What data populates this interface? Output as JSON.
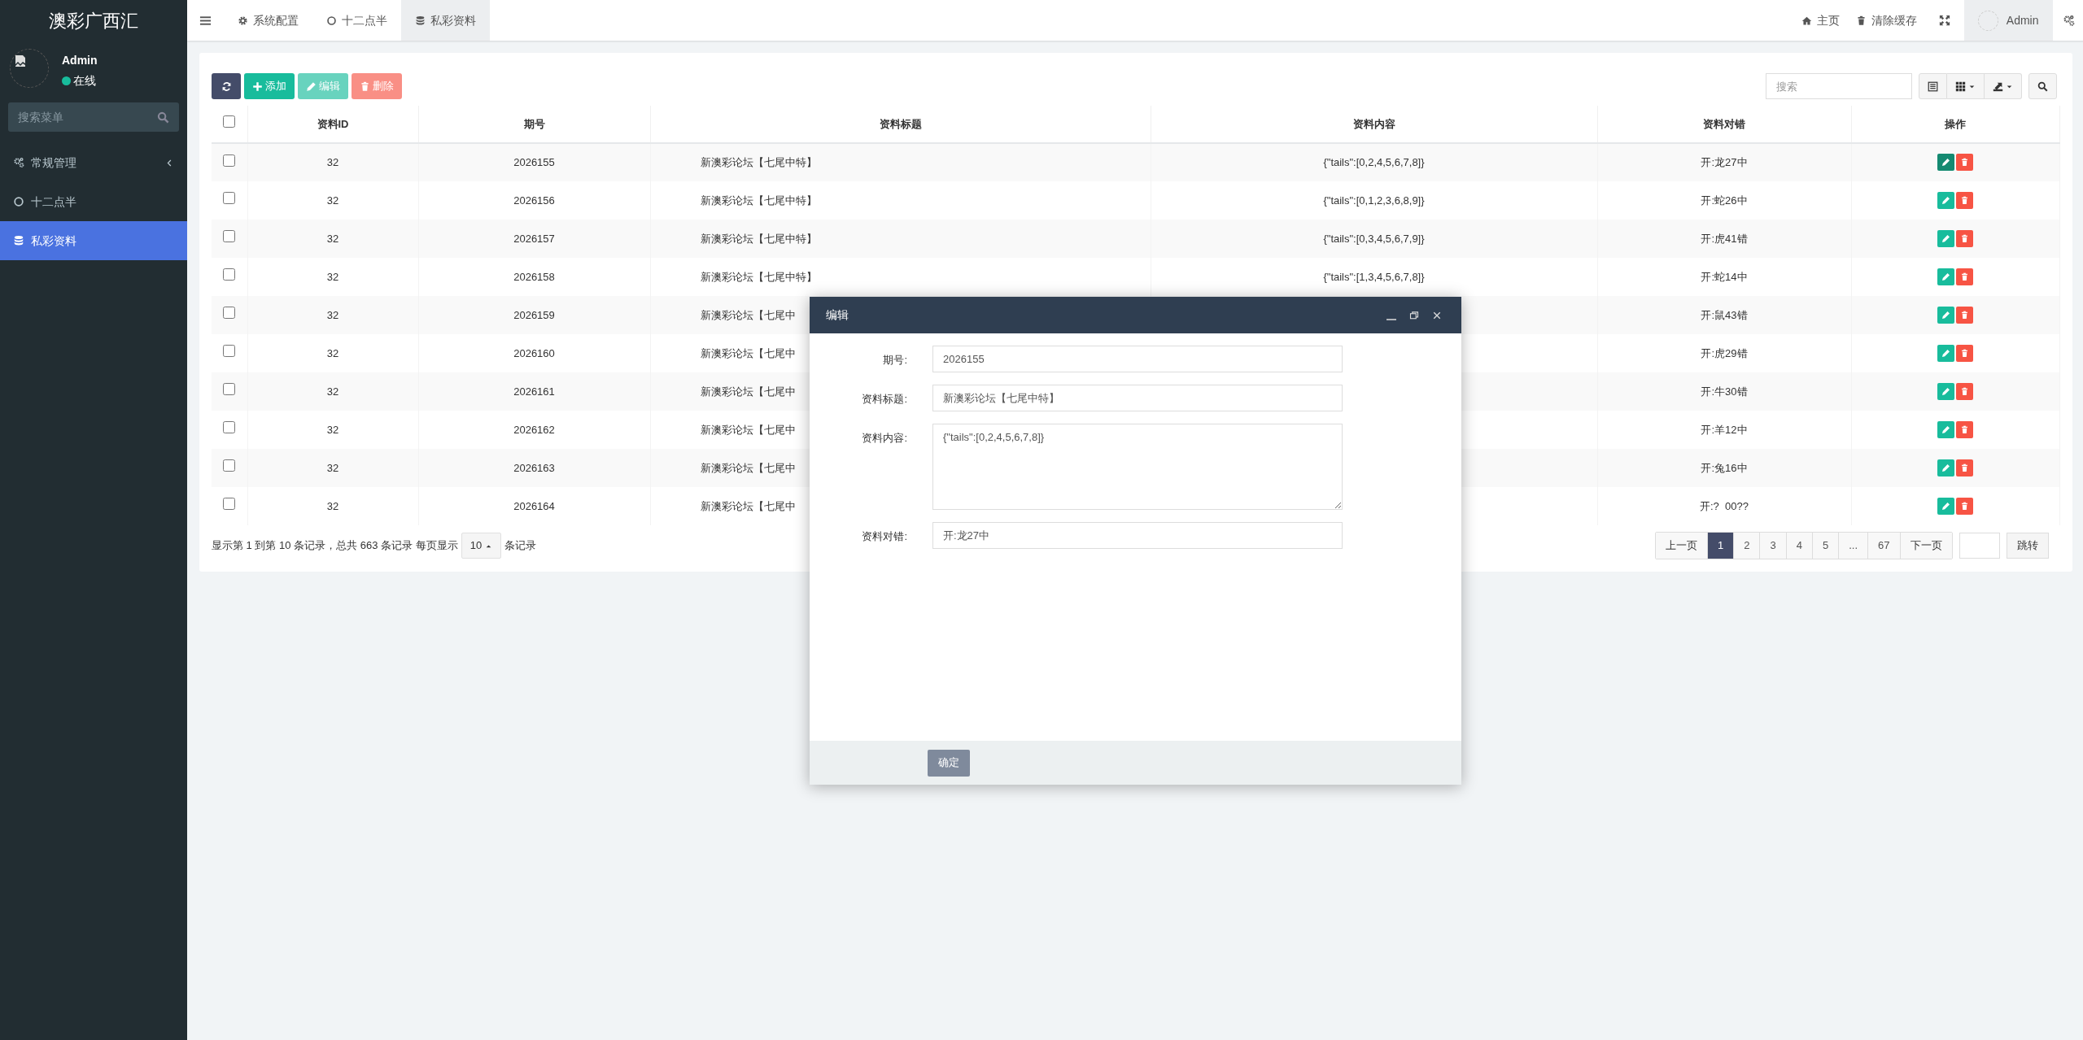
{
  "sidebar": {
    "logo": "澳彩广西汇",
    "user": {
      "name": "Admin",
      "status": "在线",
      "online": true
    },
    "search": {
      "placeholder": "搜索菜单"
    },
    "items": [
      {
        "label": "常规管理",
        "expanded": false,
        "selected": false
      },
      {
        "label": "十二点半",
        "selected": false
      },
      {
        "label": "私彩资料",
        "selected": true
      }
    ]
  },
  "topbar": {
    "tabs": [
      {
        "label": "系统配置",
        "selected": false
      },
      {
        "label": "十二点半",
        "selected": false
      },
      {
        "label": "私彩资料",
        "selected": true
      }
    ],
    "links": [
      "主页",
      "清除缓存"
    ],
    "user": "Admin"
  },
  "toolbar": {
    "buttons": [
      {
        "kind": "refresh",
        "disabled": false
      },
      {
        "kind": "add",
        "label": "添加",
        "disabled": false
      },
      {
        "kind": "edit",
        "label": "编辑",
        "disabled": true
      },
      {
        "kind": "delete",
        "label": "删除",
        "disabled": true
      }
    ],
    "search": {
      "placeholder": "搜索"
    }
  },
  "table": {
    "select_all": false,
    "columns": [
      "资料ID",
      "期号",
      "资料标题",
      "资料内容",
      "资料对错",
      "操作"
    ],
    "rows": [
      {
        "checked": false,
        "id": "32",
        "issue": "2026155",
        "title": "新澳彩论坛【七尾中特】",
        "content": "{\"tails\":[0,2,4,5,6,7,8]}",
        "result": "开:龙27中",
        "edit_hover": true
      },
      {
        "checked": false,
        "id": "32",
        "issue": "2026156",
        "title": "新澳彩论坛【七尾中特】",
        "content": "{\"tails\":[0,1,2,3,6,8,9]}",
        "result": "开:蛇26中",
        "edit_hover": false
      },
      {
        "checked": false,
        "id": "32",
        "issue": "2026157",
        "title": "新澳彩论坛【七尾中特】",
        "content": "{\"tails\":[0,3,4,5,6,7,9]}",
        "result": "开:虎41错",
        "edit_hover": false
      },
      {
        "checked": false,
        "id": "32",
        "issue": "2026158",
        "title": "新澳彩论坛【七尾中特】",
        "content": "{\"tails\":[1,3,4,5,6,7,8]}",
        "result": "开:蛇14中",
        "edit_hover": false
      },
      {
        "checked": false,
        "id": "32",
        "issue": "2026159",
        "title": "新澳彩论坛【七尾中",
        "result": "开:鼠43错",
        "edit_hover": false
      },
      {
        "checked": false,
        "id": "32",
        "issue": "2026160",
        "title": "新澳彩论坛【七尾中",
        "result": "开:虎29错",
        "edit_hover": false
      },
      {
        "checked": false,
        "id": "32",
        "issue": "2026161",
        "title": "新澳彩论坛【七尾中",
        "result": "开:牛30错",
        "edit_hover": false
      },
      {
        "checked": false,
        "id": "32",
        "issue": "2026162",
        "title": "新澳彩论坛【七尾中",
        "result": "开:羊12中",
        "edit_hover": false
      },
      {
        "checked": false,
        "id": "32",
        "issue": "2026163",
        "title": "新澳彩论坛【七尾中",
        "result": "开:兔16中",
        "edit_hover": false
      },
      {
        "checked": false,
        "id": "32",
        "issue": "2026164",
        "title": "新澳彩论坛【七尾中",
        "result": "开:?  00??",
        "edit_hover": false
      }
    ]
  },
  "footer": {
    "summary": "显示第 1 到第 10 条记录，总共 663 条记录 每页显示",
    "page_size": "10",
    "suffix": "条记录"
  },
  "pagination": {
    "prev": "上一页",
    "pages": [
      {
        "label": "1",
        "selected": true
      },
      {
        "label": "2",
        "selected": false
      },
      {
        "label": "3",
        "selected": false
      },
      {
        "label": "4",
        "selected": false
      },
      {
        "label": "5",
        "selected": false
      },
      {
        "label": "...",
        "selected": false
      },
      {
        "label": "67",
        "selected": false
      }
    ],
    "next": "下一页",
    "jump": "跳转"
  },
  "dialog": {
    "title": "编辑",
    "fields": [
      {
        "kind": "input",
        "label": "期号:",
        "value": "2026155"
      },
      {
        "kind": "input",
        "label": "资料标题:",
        "value": "新澳彩论坛【七尾中特】"
      },
      {
        "kind": "textarea",
        "label": "资料内容:",
        "value": "{\"tails\":[0,2,4,5,6,7,8]}"
      },
      {
        "kind": "input",
        "label": "资料对错:",
        "value": "开:龙27中"
      }
    ],
    "submit": "确定"
  }
}
